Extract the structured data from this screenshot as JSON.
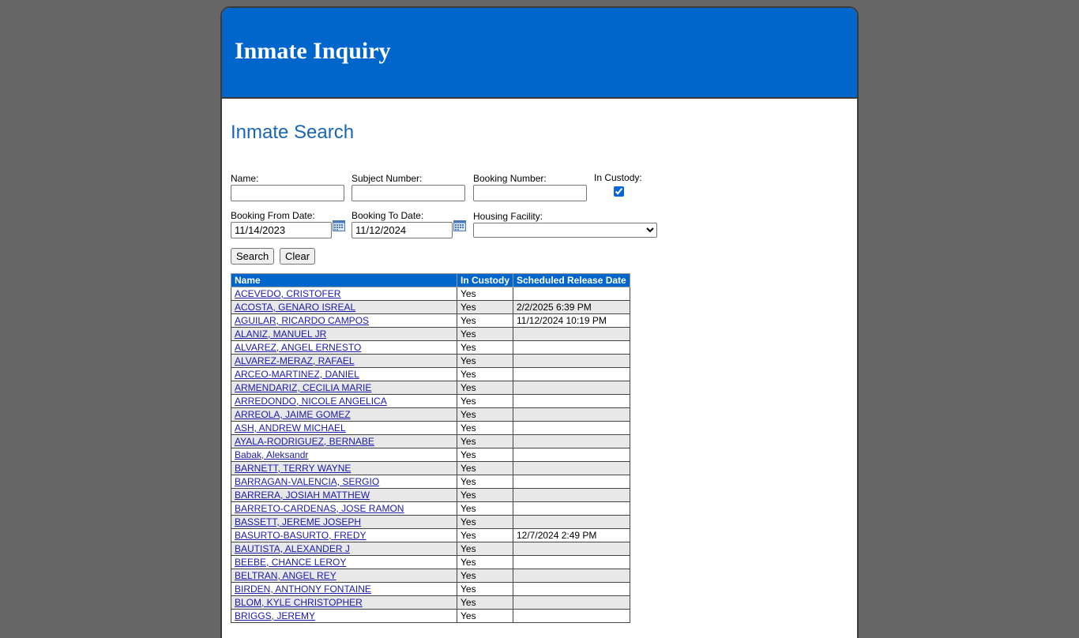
{
  "header": {
    "title": "Inmate Inquiry"
  },
  "search": {
    "section_title": "Inmate Search",
    "name_label": "Name:",
    "name_value": "",
    "subject_label": "Subject Number:",
    "subject_value": "",
    "booking_label": "Booking Number:",
    "booking_value": "",
    "custody_label": "In Custody:",
    "custody_checked": true,
    "from_label": "Booking From Date:",
    "from_value": "11/14/2023",
    "to_label": "Booking To Date:",
    "to_value": "11/12/2024",
    "facility_label": "Housing Facility:",
    "facility_value": "",
    "search_button": "Search",
    "clear_button": "Clear"
  },
  "table": {
    "headers": [
      "Name",
      "In Custody",
      "Scheduled Release Date"
    ],
    "rows": [
      {
        "name": "ACEVEDO, CRISTOFER",
        "custody": "Yes",
        "release": ""
      },
      {
        "name": "ACOSTA, GENARO ISREAL",
        "custody": "Yes",
        "release": "2/2/2025 6:39 PM"
      },
      {
        "name": "AGUILAR, RICARDO CAMPOS",
        "custody": "Yes",
        "release": "11/12/2024 10:19 PM"
      },
      {
        "name": "ALANIZ, MANUEL JR",
        "custody": "Yes",
        "release": ""
      },
      {
        "name": "ALVAREZ, ANGEL ERNESTO",
        "custody": "Yes",
        "release": ""
      },
      {
        "name": "ALVAREZ-MERAZ, RAFAEL",
        "custody": "Yes",
        "release": ""
      },
      {
        "name": "ARCEO-MARTINEZ, DANIEL",
        "custody": "Yes",
        "release": ""
      },
      {
        "name": "ARMENDARIZ, CECILIA MARIE",
        "custody": "Yes",
        "release": ""
      },
      {
        "name": "ARREDONDO, NICOLE ANGELICA",
        "custody": "Yes",
        "release": ""
      },
      {
        "name": "ARREOLA, JAIME GOMEZ",
        "custody": "Yes",
        "release": ""
      },
      {
        "name": "ASH, ANDREW MICHAEL",
        "custody": "Yes",
        "release": ""
      },
      {
        "name": "AYALA-RODRIGUEZ, BERNABE",
        "custody": "Yes",
        "release": ""
      },
      {
        "name": "Babak, Aleksandr",
        "custody": "Yes",
        "release": ""
      },
      {
        "name": "BARNETT, TERRY WAYNE",
        "custody": "Yes",
        "release": ""
      },
      {
        "name": "BARRAGAN-VALENCIA, SERGIO",
        "custody": "Yes",
        "release": ""
      },
      {
        "name": "BARRERA, JOSIAH MATTHEW",
        "custody": "Yes",
        "release": ""
      },
      {
        "name": "BARRETO-CARDENAS, JOSE RAMON",
        "custody": "Yes",
        "release": ""
      },
      {
        "name": "BASSETT, JEREME JOSEPH",
        "custody": "Yes",
        "release": ""
      },
      {
        "name": "BASURTO-BASURTO, FREDY",
        "custody": "Yes",
        "release": "12/7/2024 2:49 PM"
      },
      {
        "name": "BAUTISTA, ALEXANDER J",
        "custody": "Yes",
        "release": ""
      },
      {
        "name": "BEEBE, CHANCE LEROY",
        "custody": "Yes",
        "release": ""
      },
      {
        "name": "BELTRAN, ANGEL REY",
        "custody": "Yes",
        "release": ""
      },
      {
        "name": "BIRDEN, ANTHONY FONTAINE",
        "custody": "Yes",
        "release": ""
      },
      {
        "name": "BLOM, KYLE CHRISTOPHER",
        "custody": "Yes",
        "release": ""
      },
      {
        "name": "BRIGGS, JEREMY",
        "custody": "Yes",
        "release": ""
      }
    ]
  },
  "icons": {
    "calendar": "calendar-icon"
  },
  "colors": {
    "banner": "#0066cc",
    "background": "#666666",
    "title": "#1a66b3"
  }
}
